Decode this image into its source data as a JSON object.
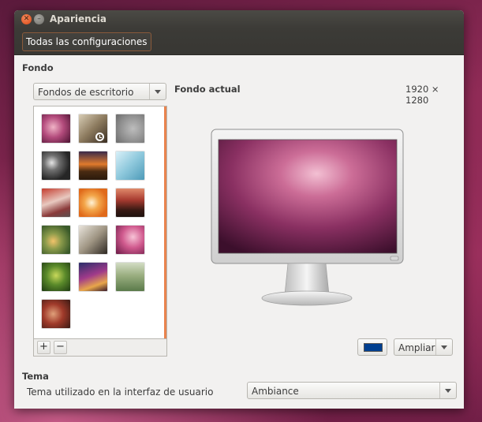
{
  "window": {
    "title": "Apariencia"
  },
  "toolbar": {
    "all_settings_label": "Todas las configuraciones"
  },
  "background": {
    "heading": "Fondo",
    "source_combo": {
      "selected": "Fondos de escritorio"
    },
    "current_label": "Fondo actual",
    "resolution": "1920 × 1280",
    "add_label": "+",
    "remove_label": "−",
    "thumbnails": [
      {
        "name": "wallpaper-warty-final",
        "bg": "radial-gradient(circle at 40% 45%, #f0b3c6 0%, #b34b7c 45%, #4a1230 100%)"
      },
      {
        "name": "wallpaper-pen-clock",
        "bg": "linear-gradient(135deg, #d8cdb5 0%, #8c7a5e 50%, #3a2e22 100%)",
        "selected": true
      },
      {
        "name": "wallpaper-grey-animal",
        "bg": "radial-gradient(circle at 60% 50%, #bdbdbd 0%, #8e8e8e 60%, #6b6b6b 100%)"
      },
      {
        "name": "wallpaper-gears",
        "bg": "radial-gradient(circle at 35% 40%, #e5e5e5 0%, #6f6f6f 30%, #262626 70%)"
      },
      {
        "name": "wallpaper-sunset-field",
        "bg": "linear-gradient(180deg, #3a2b4b 0%, #e07a2c 45%, #4a2b12 70%, #2a1a0c 100%)"
      },
      {
        "name": "wallpaper-blue-ice",
        "bg": "linear-gradient(135deg, #d9f0f8 0%, #8ec8dc 50%, #4d9ab8 100%)"
      },
      {
        "name": "wallpaper-red-tree-road",
        "bg": "linear-gradient(160deg, #c43c2e 0%, #e8c9c0 45%, #8a3a3a 75%, #5a5050 100%)"
      },
      {
        "name": "wallpaper-orange-flowers",
        "bg": "radial-gradient(circle at 45% 50%, #fff3d6 0%, #f3a64a 35%, #e06a1a 75%)"
      },
      {
        "name": "wallpaper-red-lake",
        "bg": "linear-gradient(180deg, #e08a6a 0%, #a83b30 40%, #3a1a14 75%, #1e120e 100%)"
      },
      {
        "name": "wallpaper-poppy-flowers",
        "bg": "radial-gradient(circle at 40% 55%, #f2c36a 0%, #8a9a4a 35%, #3a5a2a 80%)"
      },
      {
        "name": "wallpaper-fountain-pen",
        "bg": "linear-gradient(135deg, #e9e4dc 0%, #a09684 50%, #2e2822 100%)"
      },
      {
        "name": "wallpaper-pink-bokeh",
        "bg": "radial-gradient(circle at 60% 40%, #f7c3d6 0%, #d05a8e 45%, #6a1a45 100%)"
      },
      {
        "name": "wallpaper-green-leaves",
        "bg": "radial-gradient(circle at 50% 45%, #c8d85a 0%, #5a8a2a 45%, #1e3a12 100%)"
      },
      {
        "name": "wallpaper-fox-sunset",
        "bg": "linear-gradient(160deg, #2a2e6a 0%, #a03a8a 45%, #e8a64a 75%, #3a1a2a 100%)"
      },
      {
        "name": "wallpaper-tall-grass",
        "bg": "linear-gradient(180deg, #d2dcc4 0%, #9aae80 45%, #5a7a4a 100%)"
      },
      {
        "name": "wallpaper-autumn-leaves",
        "bg": "radial-gradient(circle at 40% 50%, #e0a07a 0%, #a03a2a 45%, #3a1a14 100%)"
      }
    ]
  },
  "desktop_color": "#003f90",
  "placement_combo": {
    "selected": "Ampliar"
  },
  "theme": {
    "heading": "Tema",
    "description": "Tema utilizado en la interfaz de usuario",
    "selected": "Ambiance"
  }
}
